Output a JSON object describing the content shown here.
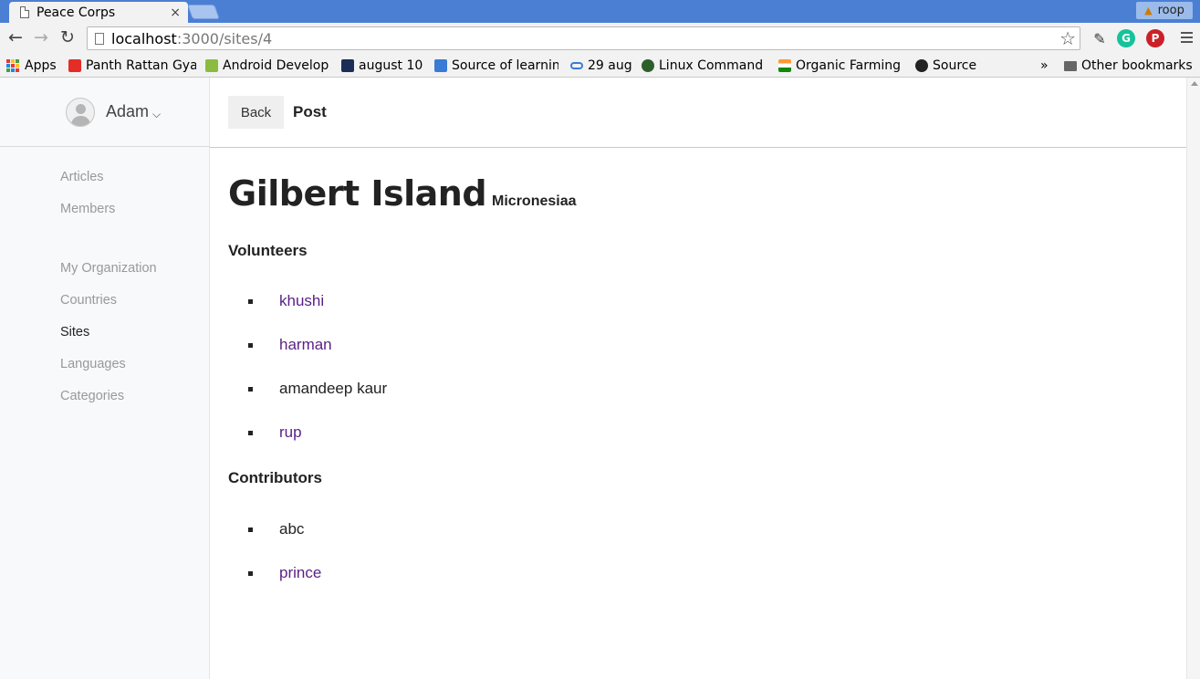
{
  "browser": {
    "tab_title": "Peace Corps",
    "tab_close": "×",
    "profile_name": "roop",
    "url_host": "localhost",
    "url_path": ":3000/sites/4",
    "bookmarks": [
      {
        "label": "Apps",
        "icon": "apps-grid-icon"
      },
      {
        "label": "Panth Rattan Gya",
        "icon": "youtube-icon",
        "color": "#e52d27"
      },
      {
        "label": "Android Develop",
        "icon": "android-icon",
        "color": "#8bbc3f"
      },
      {
        "label": "august 10",
        "icon": "qut-icon",
        "color": "#1c2e55"
      },
      {
        "label": "Source of learnin",
        "icon": "d-icon",
        "color": "#3a7bd5"
      },
      {
        "label": "29 aug",
        "icon": "link-icon",
        "color": "#3a7bd5"
      },
      {
        "label": "Linux Command",
        "icon": "globe-icon",
        "color": "#2d5f2b"
      },
      {
        "label": "Organic Farming",
        "icon": "india-flag-icon",
        "color": "#ff9933"
      },
      {
        "label": "Source",
        "icon": "github-icon",
        "color": "#222222"
      }
    ],
    "bookmarks_overflow": "»",
    "other_bookmarks": "Other bookmarks"
  },
  "sidebar": {
    "user_name": "Adam",
    "user_caret": "⌵",
    "nav": [
      {
        "label": "Articles",
        "active": false
      },
      {
        "label": "Members",
        "active": false
      },
      {
        "label": "My Organization",
        "active": false
      },
      {
        "label": "Countries",
        "active": false
      },
      {
        "label": "Sites",
        "active": true
      },
      {
        "label": "Languages",
        "active": false
      },
      {
        "label": "Categories",
        "active": false
      }
    ]
  },
  "header": {
    "back_label": "Back",
    "title": "Post"
  },
  "site": {
    "name": "Gilbert Island",
    "country": "Micronesiaa",
    "volunteers_heading": "Volunteers",
    "volunteers": [
      {
        "name": "khushi",
        "link": true
      },
      {
        "name": "harman",
        "link": true
      },
      {
        "name": "amandeep kaur",
        "link": false
      },
      {
        "name": "rup",
        "link": true
      }
    ],
    "contributors_heading": "Contributors",
    "contributors": [
      {
        "name": "abc",
        "link": false
      },
      {
        "name": "prince",
        "link": true
      }
    ]
  },
  "colors": {
    "link": "#5a1f87",
    "tabbar": "#4a7fd4",
    "sidebar_bg": "#f7f9fb"
  }
}
